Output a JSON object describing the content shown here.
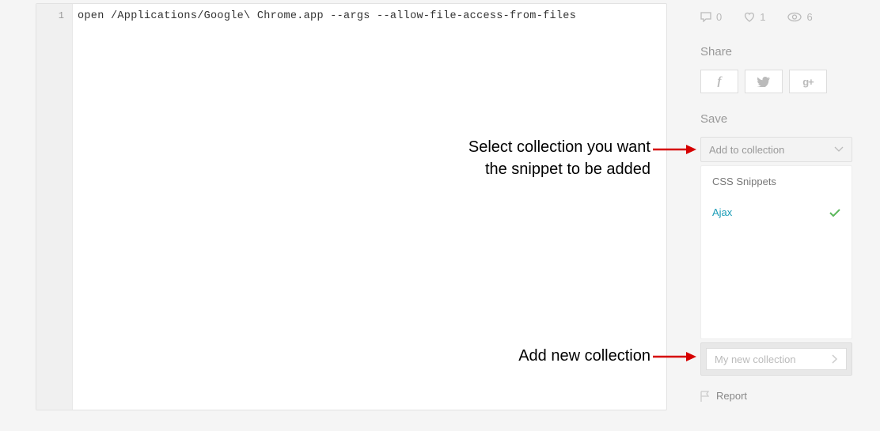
{
  "editor": {
    "lineNumber": "1",
    "code": "open /Applications/Google\\ Chrome.app --args --allow-file-access-from-files"
  },
  "stats": {
    "comments": "0",
    "likes": "1",
    "views": "6"
  },
  "share": {
    "label": "Share"
  },
  "save": {
    "label": "Save",
    "dropdownPlaceholder": "Add to collection",
    "collections": [
      {
        "name": "CSS Snippets",
        "selected": false
      },
      {
        "name": "Ajax",
        "selected": true
      }
    ],
    "newCollectionPlaceholder": "My new collection"
  },
  "report": {
    "label": "Report"
  },
  "annotations": {
    "top": "Select collection you want the snippet to be added",
    "bottom": "Add new collection"
  }
}
